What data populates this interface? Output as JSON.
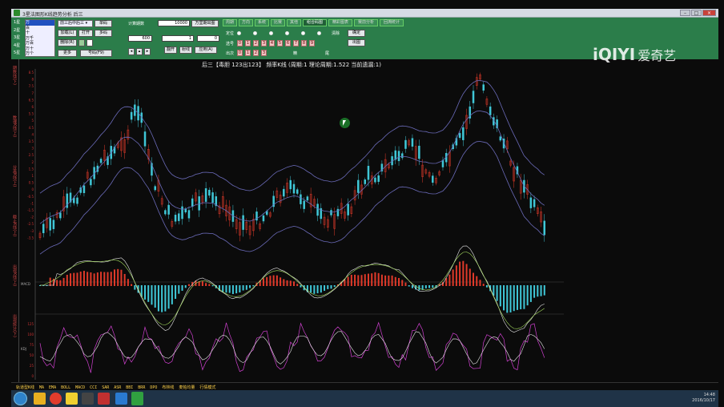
{
  "window": {
    "title": "3星法图形K线趋势分析 后三"
  },
  "left_list": {
    "rows": [
      "1星",
      "2星",
      "3星",
      "4星",
      "5星"
    ],
    "items": [
      "万",
      "百",
      "十",
      "万千",
      "万百",
      "万十",
      "万个"
    ],
    "selected": "万"
  },
  "controls": {
    "dropdown": "前三后中后三",
    "btn_single": "单码",
    "btn_load": "加载(L)",
    "btn_open": "打开",
    "btn_multi": "多码",
    "btn_delete": "删除(R)",
    "btn_more": "更多",
    "btn_code": "号码(F9)",
    "label_count": "计算期数",
    "count_value": "10000",
    "btn_wanliang": "万里期出图",
    "field_600": "600",
    "field_1": "1",
    "field_0": "0",
    "btn_flip": "翻开",
    "btn_shot": "射线",
    "btn_apply": "应用(A)"
  },
  "tabs": [
    "周期",
    "方向",
    "系统",
    "比赛",
    "其他",
    "组合码图",
    "精彩图表",
    "赛前分析",
    "回溯统计"
  ],
  "active_tab": "组合码图",
  "right_panel": {
    "row1_label": "定位",
    "row2_label": "选号",
    "row3_label": "出次",
    "numbers": [
      "0",
      "1",
      "2",
      "3",
      "4",
      "5",
      "6",
      "7",
      "8",
      "9"
    ],
    "btn_confirm": "确定",
    "btn_output": "出图",
    "label_pos": "精",
    "label_end": "尾",
    "label_clear": "清除"
  },
  "side_labels": [
    "期数线(下)",
    "数理K线(上)",
    "分离K线(上)",
    "截止K线(上)",
    "出现K线(上)",
    "出现统计(下)"
  ],
  "chart": {
    "title": "后三【毒胆 123出123】 频率K线 (周期:1 理论周期:1.522 当前遗漏:1)",
    "y_ticks_main": [
      "8.5",
      "8",
      "7.5",
      "7",
      "6.5",
      "6",
      "5.5",
      "5",
      "4.5",
      "4",
      "3.5",
      "3",
      "2.5",
      "2",
      "1.5",
      "1",
      "0.5",
      "0",
      "-0.5",
      "-1",
      "-1.5",
      "-2",
      "-2.5",
      "-3",
      "-3.5"
    ],
    "panel2_label": "MACD",
    "panel3_label": "KDJ",
    "y_ticks_kdj": [
      "125",
      "100",
      "75",
      "50",
      "25",
      "0"
    ]
  },
  "bottom_menu": [
    "轨道型K线",
    "MA",
    "EMA",
    "BOLL",
    "MACD",
    "CCI",
    "SAR",
    "ASR",
    "BBI",
    "BRR",
    "DPO",
    "布林线",
    "麦帕均量",
    "行情模式"
  ],
  "taskbar": {
    "time": "14:48",
    "date": "2016/10/17"
  },
  "watermark": {
    "logo": "iQIYI",
    "name": "爱奇艺"
  },
  "colors": {
    "toolbar": "#2b7d4a",
    "bull": "#e03a2a",
    "bear": "#40c8d8",
    "bands": "#6a6ab8",
    "macd_fast": "#e8e8e8",
    "macd_slow": "#a8e060",
    "kdj_k": "#d040d0",
    "kdj_d": "#e8e8e8"
  }
}
